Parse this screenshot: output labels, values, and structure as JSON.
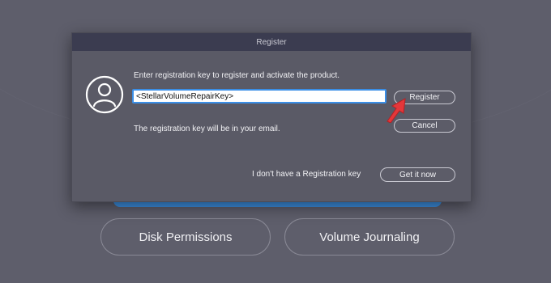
{
  "dialog": {
    "title": "Register",
    "instruction": "Enter registration key to register and activate the product.",
    "key_input_value": "<StellarVolumeRepairKey>",
    "register_label": "Register",
    "cancel_label": "Cancel",
    "email_note": "The registration key will be in your email.",
    "no_key_label": "I don't have a Registration key",
    "get_it_now_label": "Get it now",
    "avatar_icon": "user-avatar-icon"
  },
  "background": {
    "disk_permissions_label": "Disk Permissions",
    "volume_journaling_label": "Volume Journaling",
    "accent_color": "#3d8fe0"
  },
  "annotation": {
    "arrow_icon": "red-pointer-arrow-icon",
    "arrow_color": "#e5373a"
  }
}
